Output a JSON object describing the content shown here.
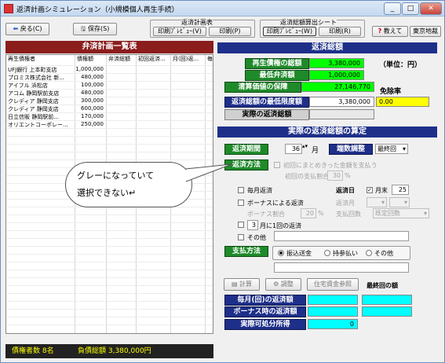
{
  "window": {
    "title": "返済計画シミュレーション（小規模個人再生手続）",
    "min": "_",
    "max": "□",
    "close": "✕"
  },
  "toolbar": {
    "back": "戻る(C)",
    "save": "保存(S)",
    "plan_group": "返済計画表",
    "plan_preview": "印刷ﾌﾟﾚﾋﾞｭｰ(V)",
    "plan_print": "印刷(P)",
    "sheet_group": "返済総額算出シート",
    "sheet_preview": "印刷ﾌﾟﾚﾋﾞｭｰ(W)",
    "sheet_print": "印刷(R)",
    "help": "教えて",
    "firm": "東京地裁"
  },
  "left": {
    "title": "弁済計画一覧表",
    "columns": [
      "再生債権者",
      "債権額",
      "弁済総額",
      "初回返済...",
      "月(回)返...",
      "毎"
    ],
    "rows": [
      {
        "name": "UFJ銀行 上本町支店",
        "amount": "1,000,000"
      },
      {
        "name": "プロミス株式会社 新...",
        "amount": "480,000"
      },
      {
        "name": "アイフル 浜松店",
        "amount": "100,000"
      },
      {
        "name": "アコム 静岡駅前支店",
        "amount": "480,000"
      },
      {
        "name": "クレディア 静岡支店",
        "amount": "300,000"
      },
      {
        "name": "クレディア 静岡支店",
        "amount": "600,000"
      },
      {
        "name": "日立信販 静岡駅前...",
        "amount": "170,000"
      },
      {
        "name": "オリエントコーポレー...",
        "amount": "250,000"
      }
    ],
    "footer_count": "債権者数 8名",
    "footer_total": "負債総額 3,380,000円"
  },
  "summary": {
    "title": "返済総額",
    "total_label": "再生債権の総額",
    "total_value": "3,380,000",
    "unit": "（単位：円）",
    "min_label": "最低弁済額",
    "min_value": "1,000,000",
    "liq_label": "清算価値の保障",
    "liq_value": "27,146,770",
    "exempt_label": "免除率",
    "lower_label": "返済総額の最低限度額",
    "lower_value": "3,380,000",
    "exempt_value": "0.00",
    "actual_label": "実際の返済総額"
  },
  "calc": {
    "title": "実際の返済総額の算定",
    "period_label": "返済期間",
    "period_value": "36",
    "month_unit": "月",
    "fraction_label": "端数調整",
    "fraction_value": "最終回",
    "method_label": "返済方法",
    "bulk_label": "初回にまとめきった金額を支払う",
    "first_ratio_label": "初回の支払割合",
    "first_ratio_value": "30",
    "percent": "%",
    "monthly_label": "毎月返済",
    "due_label": "返済日",
    "month_end_label": "月末",
    "due_day": "25",
    "bonus_label": "ボーナスによる返済",
    "bonus_month_label": "返済月",
    "bonus_ratio_label": "ボーナス割合",
    "bonus_ratio_value": "20",
    "pay_count_label": "支払回数",
    "pay_count_value": "既定回数",
    "interval_value": "3",
    "interval_label": "月に1回の返済",
    "other_label": "その他",
    "pay_method_label": "支払方法",
    "transfer": "振込送金",
    "bring": "持参払い",
    "other2": "その他",
    "calc_btn": "計算",
    "adjust_btn": "調整",
    "housing_btn": "住宅資金参照",
    "final_label": "最終回の額",
    "monthly_amt_label": "毎月(回)の返済額",
    "bonus_amt_label": "ボーナス時の返済額",
    "disposable_label": "実際可処分所得",
    "disposable_value": "0"
  },
  "callout": {
    "line1": "グレーになっていて",
    "line2": "選択できない↵"
  },
  "colors": {
    "navy": "#1e2f8a",
    "green": "#1f8a2a",
    "maroon": "#8b1d1d",
    "lime": "#00ff00",
    "cyan": "#00ffff",
    "yellow": "#ffff00"
  }
}
